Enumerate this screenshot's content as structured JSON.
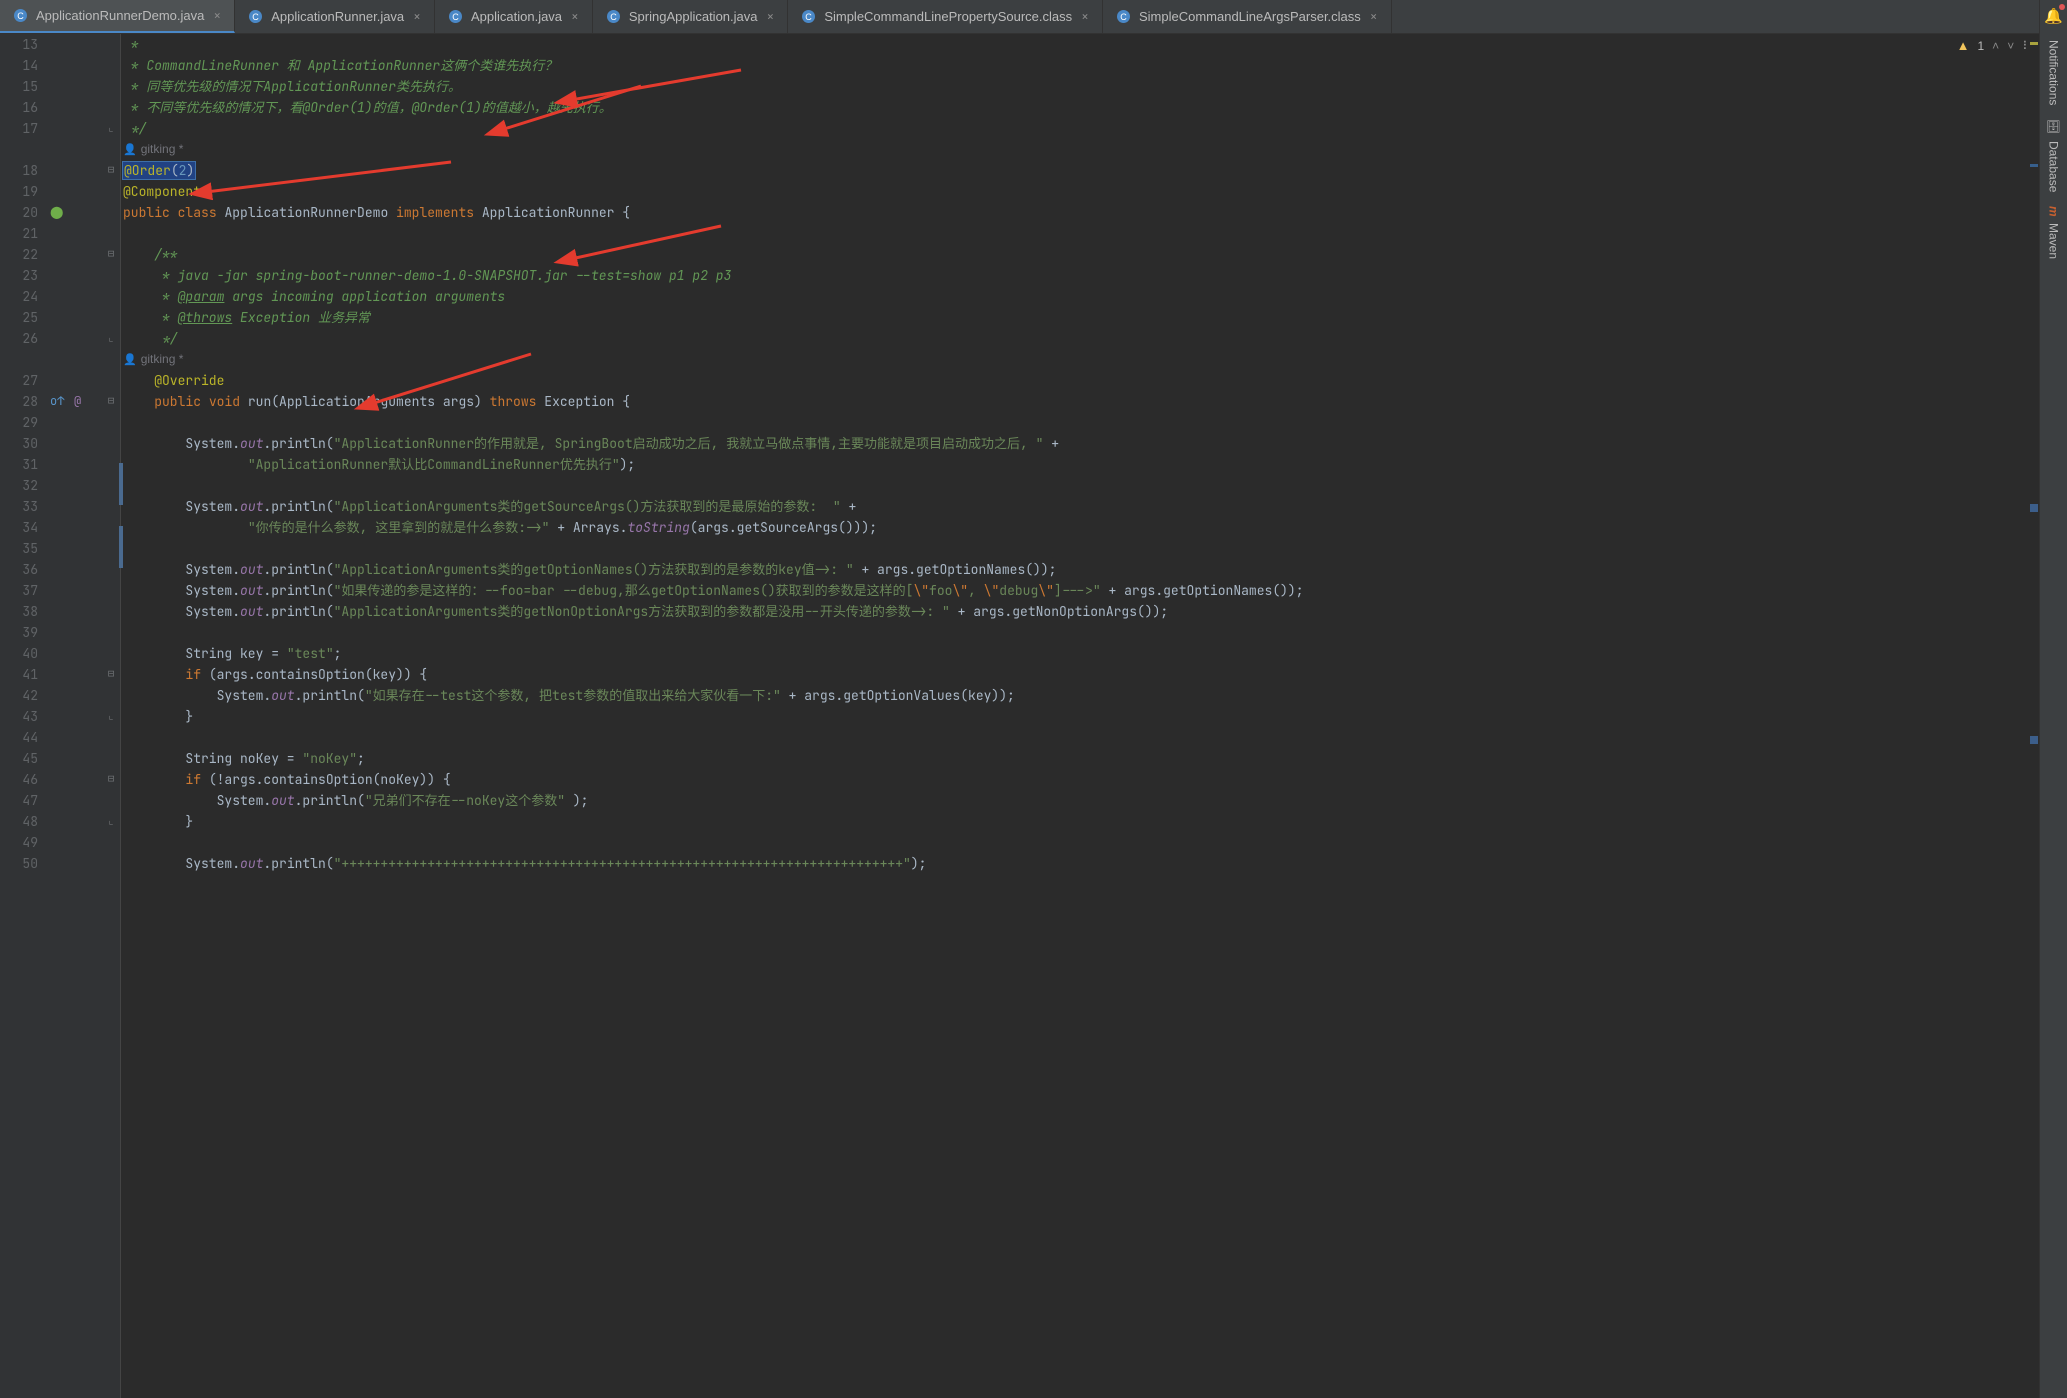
{
  "tabs": [
    {
      "label": "ApplicationRunnerDemo.java",
      "icon": "java-class",
      "active": true
    },
    {
      "label": "ApplicationRunner.java",
      "icon": "java-interface",
      "active": false
    },
    {
      "label": "Application.java",
      "icon": "java-class",
      "active": false
    },
    {
      "label": "SpringApplication.java",
      "icon": "java-class",
      "active": false
    },
    {
      "label": "SimpleCommandLinePropertySource.class",
      "icon": "java-class",
      "active": false
    },
    {
      "label": "SimpleCommandLineArgsParser.class",
      "icon": "java-class",
      "active": false
    }
  ],
  "sidebar": {
    "notifications": "Notifications",
    "database": "Database",
    "maven": "Maven"
  },
  "status": {
    "warn_count": "1"
  },
  "lines": {
    "start": 13,
    "items": [
      {
        "n": 13,
        "type": "doc",
        "text": " *"
      },
      {
        "n": 14,
        "type": "doc",
        "text": " * CommandLineRunner 和 ApplicationRunner这俩个类谁先执行？"
      },
      {
        "n": 15,
        "type": "doc",
        "text": " * 同等优先级的情况下ApplicationRunner类先执行。"
      },
      {
        "n": 16,
        "type": "doc",
        "text": " * 不同等优先级的情况下，看@Order(1)的值，@Order(1)的值越小，越先执行。"
      },
      {
        "n": 17,
        "type": "doc",
        "text": " */",
        "fold": "end"
      },
      {
        "n": null,
        "type": "author",
        "text": "gitking *"
      },
      {
        "n": 18,
        "type": "code",
        "html": "<span class='hl-sel'><span class='c-annot'>@Order</span>(<span class='c-num'>2</span>)</span>",
        "fold": "start"
      },
      {
        "n": 19,
        "type": "code",
        "html": "<span class='c-annot'>@Component</span>"
      },
      {
        "n": 20,
        "type": "code",
        "html": "<span class='c-keyword'>public</span> <span class='c-keyword'>class</span> ApplicationRunnerDemo <span class='c-keyword'>implements</span> ApplicationRunner {",
        "ann": "spring"
      },
      {
        "n": 21,
        "type": "code",
        "html": ""
      },
      {
        "n": 22,
        "type": "doc",
        "text": "    /**",
        "fold": "start"
      },
      {
        "n": 23,
        "type": "doc",
        "text": "     * java -jar spring-boot-runner-demo-1.0-SNAPSHOT.jar --test=show p1 p2 p3"
      },
      {
        "n": 24,
        "type": "code",
        "html": "<span class='c-doc'>     * </span><span class='c-doctag'>@param</span><span class='c-doc'> args incoming application arguments</span>"
      },
      {
        "n": 25,
        "type": "code",
        "html": "<span class='c-doc'>     * </span><span class='c-doctag'>@throws</span><span class='c-doc'> Exception 业务异常</span>"
      },
      {
        "n": 26,
        "type": "doc",
        "text": "     */",
        "fold": "end"
      },
      {
        "n": null,
        "type": "author",
        "text": "gitking *",
        "indent": 1
      },
      {
        "n": 27,
        "type": "code",
        "html": "    <span class='c-annot'>@Override</span>"
      },
      {
        "n": 28,
        "type": "code",
        "html": "    <span class='c-keyword'>public</span> <span class='c-keyword'>void</span> <span class='c-method'>run</span>(ApplicationArguments args) <span class='c-keyword'>throws</span> Exception {",
        "fold": "start",
        "ann": "override"
      },
      {
        "n": 29,
        "type": "code",
        "html": ""
      },
      {
        "n": 30,
        "type": "code",
        "html": "        System.<span class='c-field'>out</span>.println(<span class='c-string'>\"ApplicationRunner的作用就是, SpringBoot启动成功之后, 我就立马做点事情,主要功能就是项目启动成功之后, \"</span> +"
      },
      {
        "n": 31,
        "type": "code",
        "html": "                <span class='c-string'>\"ApplicationRunner默认比CommandLineRunner优先执行\"</span>);"
      },
      {
        "n": 32,
        "type": "code",
        "html": ""
      },
      {
        "n": 33,
        "type": "code",
        "html": "        System.<span class='c-field'>out</span>.println(<span class='c-string'>\"ApplicationArguments类的getSourceArgs()方法获取到的是最原始的参数:  \"</span> +"
      },
      {
        "n": 34,
        "type": "code",
        "html": "                <span class='c-string'>\"你传的是什么参数, 这里拿到的就是什么参数:->\"</span> + Arrays.<span class='c-field'>toString</span>(args.getSourceArgs()));"
      },
      {
        "n": 35,
        "type": "code",
        "html": ""
      },
      {
        "n": 36,
        "type": "code",
        "html": "        System.<span class='c-field'>out</span>.println(<span class='c-string'>\"ApplicationArguments类的getOptionNames()方法获取到的是参数的key值->: \"</span> + args.getOptionNames());"
      },
      {
        "n": 37,
        "type": "code",
        "html": "        System.<span class='c-field'>out</span>.println(<span class='c-string'>\"如果传递的参是这样的：--foo=bar --debug,那么getOptionNames()获取到的参数是这样的[</span><span class='c-esc'>\\\"</span><span class='c-string'>foo</span><span class='c-esc'>\\\"</span><span class='c-string'>, </span><span class='c-esc'>\\\"</span><span class='c-string'>debug</span><span class='c-esc'>\\\"</span><span class='c-string'>]--->\"</span> + args.getOptionNames());"
      },
      {
        "n": 38,
        "type": "code",
        "html": "        System.<span class='c-field'>out</span>.println(<span class='c-string'>\"ApplicationArguments类的getNonOptionArgs方法获取到的参数都是没用--开头传递的参数->: \"</span> + args.getNonOptionArgs());"
      },
      {
        "n": 39,
        "type": "code",
        "html": ""
      },
      {
        "n": 40,
        "type": "code",
        "html": "        String key = <span class='c-string'>\"test\"</span>;"
      },
      {
        "n": 41,
        "type": "code",
        "html": "        <span class='c-keyword'>if</span> (args.containsOption(key)) {",
        "fold": "start"
      },
      {
        "n": 42,
        "type": "code",
        "html": "            System.<span class='c-field'>out</span>.println(<span class='c-string'>\"如果存在--test这个参数, 把test参数的值取出来给大家伙看一下:\"</span> + args.getOptionValues(key));"
      },
      {
        "n": 43,
        "type": "code",
        "html": "        }",
        "fold": "end"
      },
      {
        "n": 44,
        "type": "code",
        "html": ""
      },
      {
        "n": 45,
        "type": "code",
        "html": "        String noKey = <span class='c-string'>\"noKey\"</span>;"
      },
      {
        "n": 46,
        "type": "code",
        "html": "        <span class='c-keyword'>if</span> (!args.containsOption(noKey)) {",
        "fold": "start"
      },
      {
        "n": 47,
        "type": "code",
        "html": "            System.<span class='c-field'>out</span>.println(<span class='c-string'>\"兄弟们不存在--noKey这个参数\"</span> );"
      },
      {
        "n": 48,
        "type": "code",
        "html": "        }",
        "fold": "end"
      },
      {
        "n": 49,
        "type": "code",
        "html": ""
      },
      {
        "n": 50,
        "type": "code",
        "html": "        System.<span class='c-field'>out</span>.println(<span class='c-string'>\"++++++++++++++++++++++++++++++++++++++++++++++++++++++++++++++++++++++++\"</span>);"
      }
    ]
  }
}
